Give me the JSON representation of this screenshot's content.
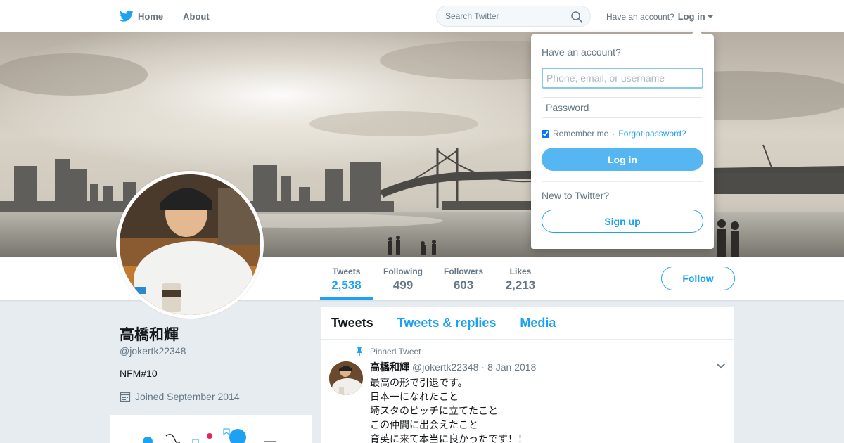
{
  "colors": {
    "accent": "#1da1f2",
    "login_button": "#55b6f2",
    "page_bg": "#e6ecf0"
  },
  "nav": {
    "home_label": "Home",
    "about_label": "About",
    "search_placeholder": "Search Twitter",
    "have_account": "Have an account?",
    "login_label": "Log in"
  },
  "stats": [
    {
      "label": "Tweets",
      "value": "2,538"
    },
    {
      "label": "Following",
      "value": "499"
    },
    {
      "label": "Followers",
      "value": "603"
    },
    {
      "label": "Likes",
      "value": "2,213"
    }
  ],
  "follow_label": "Follow",
  "profile": {
    "name": "高橋和輝",
    "handle": "@jokertk22348",
    "bio": "NFM#10",
    "joined": "Joined September 2014"
  },
  "timeline": {
    "tabs": [
      "Tweets",
      "Tweets & replies",
      "Media"
    ],
    "tweet": {
      "pinned_label": "Pinned Tweet",
      "name": "高橋和輝",
      "handle": "@jokertk22348",
      "separator": "·",
      "date": "8 Jan 2018",
      "lines": [
        "最高の形で引退です。",
        "日本一になれたこと",
        "埼スタのピッチに立てたこと",
        "この仲間に出会えたこと",
        "育英に来て本当に良かったです！！"
      ]
    }
  },
  "login_dropdown": {
    "title": "Have an account?",
    "username_placeholder": "Phone, email, or username",
    "password_placeholder": "Password",
    "remember_label": "Remember me",
    "separator": "·",
    "forgot_label": "Forgot password?",
    "login_button": "Log in",
    "new_label": "New to Twitter?",
    "signup_button": "Sign up"
  },
  "icons": [
    "twitter-bird-icon",
    "home-icon",
    "search-icon",
    "caret-down-icon",
    "calendar-icon",
    "pin-icon",
    "chevron-down-icon"
  ]
}
